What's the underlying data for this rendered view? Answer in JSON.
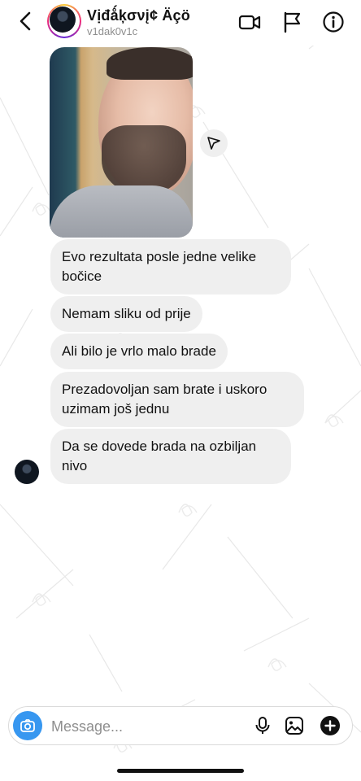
{
  "header": {
    "display_name": "Vịđǻķσνį¢ Äçö",
    "username": "v1dak0v1c",
    "icons": [
      "back-chevron-icon",
      "video-call-icon",
      "flag-icon",
      "info-icon"
    ]
  },
  "messages": [
    {
      "type": "image",
      "alt": "photo",
      "share_icon": "paper-plane-icon"
    },
    {
      "type": "text",
      "text": "Evo rezultata posle jedne velike bočice"
    },
    {
      "type": "text",
      "text": "Nemam sliku od prije"
    },
    {
      "type": "text",
      "text": "Ali bilo je vrlo malo brade"
    },
    {
      "type": "text",
      "text": "Prezadovoljan sam brate i uskoro uzimam još jednu"
    },
    {
      "type": "text",
      "text": "Da se dovede brada na ozbiljan nivo"
    }
  ],
  "composer": {
    "placeholder": "Message...",
    "icons": [
      "camera-icon",
      "microphone-icon",
      "gallery-icon",
      "plus-icon"
    ]
  },
  "colors": {
    "bubble_bg": "#efefef",
    "camera_button": "#3797f0",
    "text": "#111111",
    "muted": "#8e8e8e"
  }
}
